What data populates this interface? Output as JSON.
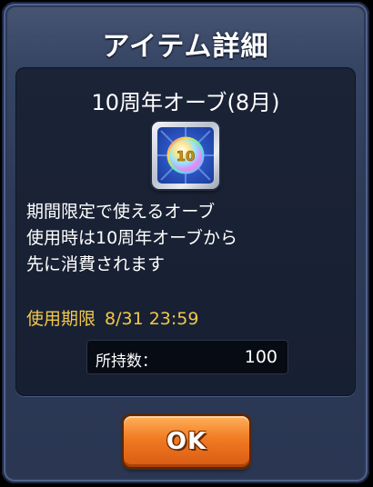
{
  "dialog": {
    "title": "アイテム詳細"
  },
  "item": {
    "name": "10周年オーブ(8月)",
    "icon": "rainbow-orb-10th-anniversary-icon",
    "icon_badge_text": "10",
    "description_lines": [
      "期間限定で使えるオーブ",
      "使用時は10周年オーブから",
      "先に消費されます"
    ],
    "expiry_label": "使用期限",
    "expiry_value": "8/31 23:59"
  },
  "holdings": {
    "label": "所持数：",
    "value": "100"
  },
  "buttons": {
    "ok_label": "OK"
  },
  "colors": {
    "dialog_bg": "#2d3b58",
    "panel_bg": "#1b2336",
    "expiry_text": "#f2c84a",
    "ok_button": "#f07a22"
  }
}
